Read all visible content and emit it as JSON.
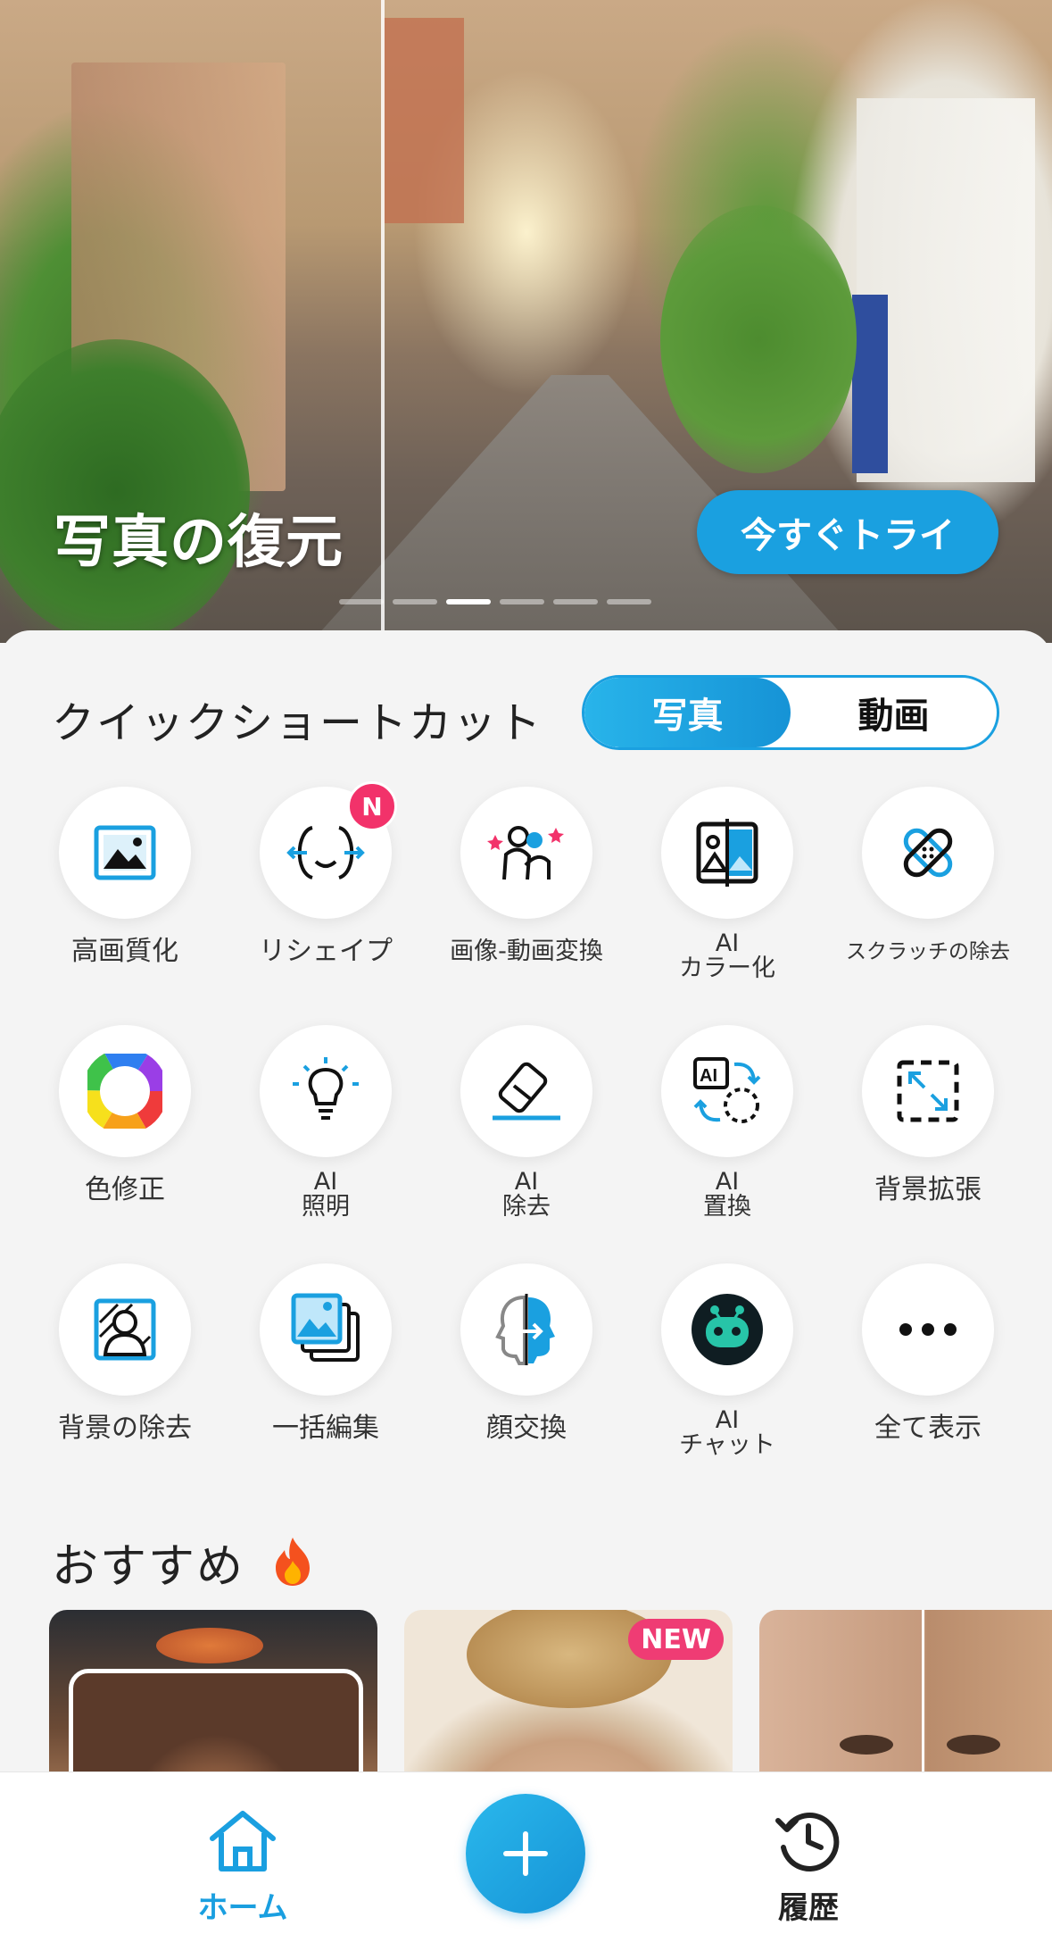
{
  "hero": {
    "title": "写真の復元",
    "cta": "今すぐトライ",
    "pages": 6,
    "active_page": 3
  },
  "quick": {
    "title": "クイックショートカット",
    "segments": [
      "写真",
      "動画"
    ],
    "selected_segment": "写真",
    "items": [
      {
        "label": "高画質化",
        "icon": "enhance-image-icon"
      },
      {
        "label": "リシェイプ",
        "icon": "reshape-face-icon",
        "badge": "N"
      },
      {
        "label": "画像-動画変換",
        "icon": "image-to-video-icon"
      },
      {
        "label": "AI\nカラー化",
        "icon": "ai-colorize-icon"
      },
      {
        "label": "スクラッチの除去",
        "icon": "scratch-removal-icon"
      },
      {
        "label": "色修正",
        "icon": "color-wheel-icon"
      },
      {
        "label": "AI\n照明",
        "icon": "ai-lighting-icon"
      },
      {
        "label": "AI\n除去",
        "icon": "ai-eraser-icon"
      },
      {
        "label": "AI\n置換",
        "icon": "ai-replace-icon"
      },
      {
        "label": "背景拡張",
        "icon": "background-expand-icon"
      },
      {
        "label": "背景の除去",
        "icon": "background-remove-icon"
      },
      {
        "label": "一括編集",
        "icon": "batch-edit-icon"
      },
      {
        "label": "顔交換",
        "icon": "face-swap-icon"
      },
      {
        "label": "AI\nチャット",
        "icon": "ai-chat-icon"
      },
      {
        "label": "全て表示",
        "icon": "more-icon"
      }
    ]
  },
  "recommended": {
    "title": "おすすめ",
    "new_badge": "NEW"
  },
  "nav": {
    "home": "ホーム",
    "history": "履歴"
  },
  "colors": {
    "accent": "#1aa0e0",
    "badge": "#f2326a",
    "new_badge": "#ef3c74"
  }
}
